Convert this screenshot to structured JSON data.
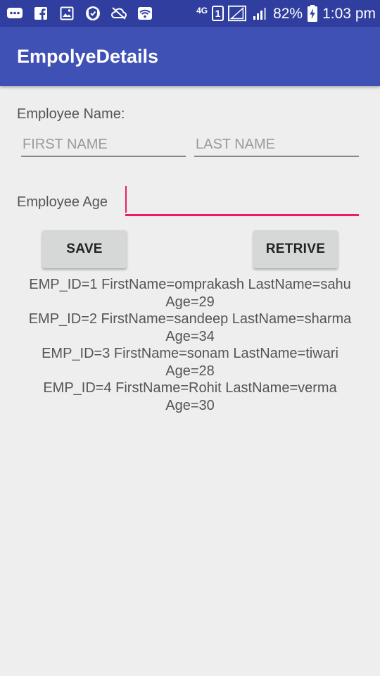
{
  "status_bar": {
    "network_type": "4G",
    "sim_slot": "1",
    "battery_percent": "82%",
    "time": "1:03 pm",
    "icons": [
      "messages-icon",
      "facebook-icon",
      "gallery-icon",
      "vpn-icon",
      "sync-off-icon",
      "wifi-icon",
      "signal-icon",
      "battery-charging-icon"
    ]
  },
  "app_bar": {
    "title": "EmpolyeDetails",
    "color": "#3f51b5"
  },
  "form": {
    "name_label": "Employee Name:",
    "first_name_placeholder": "FIRST NAME",
    "first_name_value": "",
    "last_name_placeholder": "LAST NAME",
    "last_name_value": "",
    "age_label": "Employee Age",
    "age_value": "",
    "focus_color": "#e91e63"
  },
  "buttons": {
    "save": "SAVE",
    "retrieve": "RETRIVE"
  },
  "records": [
    {
      "line1": "EMP_ID=1 FirstName=omprakash LastName=sahu",
      "line2": "Age=29"
    },
    {
      "line1": "EMP_ID=2 FirstName=sandeep LastName=sharma",
      "line2": "Age=34"
    },
    {
      "line1": "EMP_ID=3 FirstName=sonam LastName=tiwari",
      "line2": "Age=28"
    },
    {
      "line1": "EMP_ID=4 FirstName=Rohit LastName=verma",
      "line2": "Age=30"
    }
  ]
}
